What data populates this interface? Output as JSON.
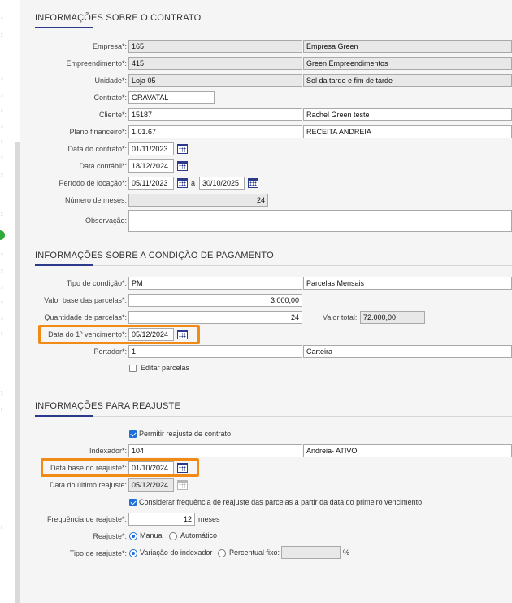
{
  "contract_section": {
    "title": "INFORMAÇÕES SOBRE O CONTRATO",
    "empresa": {
      "label": "Empresa*:",
      "code": "165",
      "name": "Empresa Green"
    },
    "empreendimento": {
      "label": "Empreendimento*:",
      "code": "415",
      "name": "Green Empreendimentos"
    },
    "unidade": {
      "label": "Unidade*:",
      "code": "Loja 05",
      "name": "Sol da tarde e fim de tarde"
    },
    "contrato": {
      "label": "Contrato*:",
      "value": "GRAVATAL"
    },
    "cliente": {
      "label": "Cliente*:",
      "code": "15187",
      "name": "Rachel Green teste"
    },
    "plano": {
      "label": "Plano financeiro*:",
      "code": "1.01.67",
      "name": "RECEITA ANDREIA"
    },
    "data_contrato": {
      "label": "Data do contrato*:",
      "value": "01/11/2023"
    },
    "data_contabil": {
      "label": "Data contábil*:",
      "value": "18/12/2024"
    },
    "periodo": {
      "label": "Período de locação*:",
      "start": "05/11/2023",
      "sep": "a",
      "end": "30/10/2025"
    },
    "meses": {
      "label": "Número de meses:",
      "value": "24"
    },
    "observacao": {
      "label": "Observação:",
      "value": ""
    }
  },
  "payment_section": {
    "title": "INFORMAÇÕES SOBRE A CONDIÇÃO DE PAGAMENTO",
    "tipo": {
      "label": "Tipo de condição*:",
      "code": "PM",
      "name": "Parcelas Mensais"
    },
    "valor_base": {
      "label": "Valor base das parcelas*:",
      "value": "3.000,00"
    },
    "quantidade": {
      "label": "Quantidade de parcelas*:",
      "value": "24"
    },
    "valor_total": {
      "label": "Valor total:",
      "value": "72.000,00"
    },
    "primeiro_venc": {
      "label": "Data do 1º vencimento*:",
      "value": "05/12/2024"
    },
    "portador": {
      "label": "Portador*:",
      "code": "1",
      "name": "Carteira"
    },
    "editar": {
      "label": "Editar parcelas",
      "checked": false
    }
  },
  "readjust_section": {
    "title": "INFORMAÇÕES PARA REAJUSTE",
    "permitir": {
      "label": "Permitir reajuste de contrato",
      "checked": true
    },
    "indexador": {
      "label": "Indexador*:",
      "code": "104",
      "name": "Andreia- ATIVO"
    },
    "data_base": {
      "label": "Data base do reajuste*:",
      "value": "01/10/2024"
    },
    "ultimo": {
      "label": "Data do último reajuste:",
      "value": "05/12/2024"
    },
    "considerar": {
      "label": "Considerar frequência de reajuste das parcelas a partir da data do primeiro vencimento",
      "checked": true
    },
    "frequencia": {
      "label": "Frequência de reajuste*:",
      "value": "12",
      "unit": "meses"
    },
    "reajuste": {
      "label": "Reajuste*:",
      "opt1": "Manual",
      "opt2": "Automático",
      "selected": "Manual"
    },
    "tipo_reajuste": {
      "label": "Tipo de reajuste*:",
      "opt1": "Variação do indexador",
      "opt2": "Percentual fixo:",
      "percent_value": "",
      "percent_unit": "%",
      "selected": "Variação do indexador"
    }
  },
  "colors": {
    "accent": "#2b3a8a",
    "highlight": "#f28a16",
    "checkbox": "#1e6fd9",
    "status_dot": "#2eaa3a"
  },
  "icons": [
    "chevron-right-icon",
    "calendar-icon",
    "checkbox-icon",
    "radio-icon"
  ]
}
